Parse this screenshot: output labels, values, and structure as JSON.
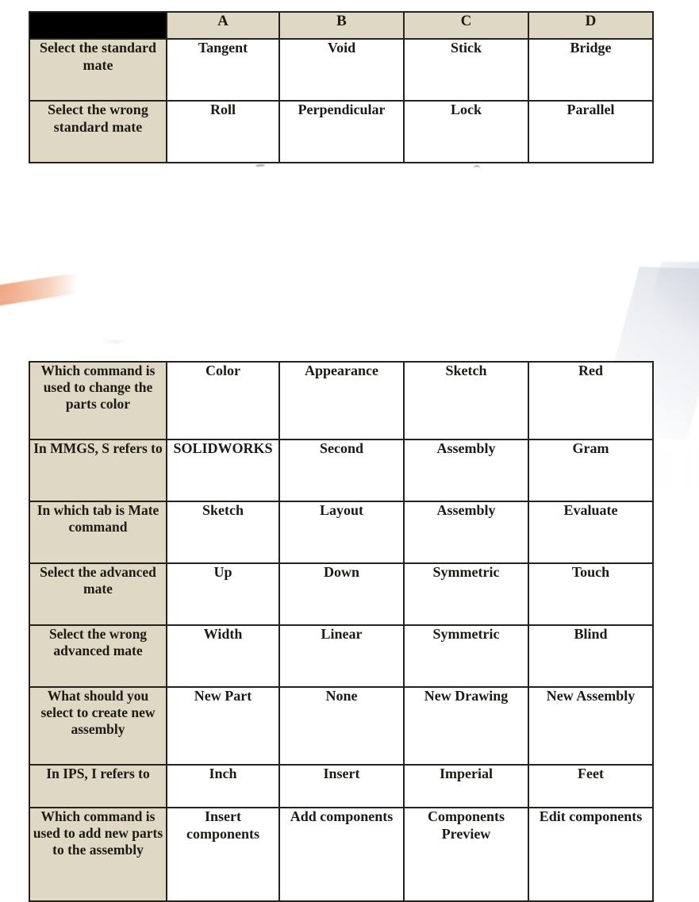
{
  "page": {
    "background_color": "#ffffff",
    "prompt_column_color": "#ded8c4",
    "header_blank_color": "#000000",
    "border_color": "#25211c",
    "option_cell_color": "#ffffff"
  },
  "tables": [
    {
      "id": "table-standard-mates",
      "has_header": true,
      "header": {
        "blank_label": "",
        "columns": [
          "A",
          "B",
          "C",
          "D"
        ]
      },
      "rows": [
        {
          "prompt": "Select the standard mate",
          "options": [
            "Tangent",
            "Void",
            "Stick",
            "Bridge"
          ],
          "height_class": "2"
        },
        {
          "prompt": "Select the wrong standard mate",
          "options": [
            "Roll",
            "Perpendicular",
            "Lock",
            "Parallel"
          ],
          "height_class": "2"
        }
      ]
    },
    {
      "id": "table-commands",
      "has_header": false,
      "rows": [
        {
          "prompt": "Which command is used to change the parts color",
          "options": [
            "Color",
            "Appearance",
            "Sketch",
            "Red"
          ],
          "height_class": "3"
        },
        {
          "prompt": "In MMGS, S refers to",
          "options": [
            "SOLIDWORKS",
            "Second",
            "Assembly",
            "Gram"
          ],
          "height_class": "2"
        },
        {
          "prompt": "In which tab is Mate command",
          "options": [
            "Sketch",
            "Layout",
            "Assembly",
            "Evaluate"
          ],
          "height_class": "2"
        },
        {
          "prompt": "Select the advanced mate",
          "options": [
            "Up",
            "Down",
            "Symmetric",
            "Touch"
          ],
          "height_class": "2"
        },
        {
          "prompt": "Select the wrong advanced mate",
          "options": [
            "Width",
            "Linear",
            "Symmetric",
            "Blind"
          ],
          "height_class": "2"
        },
        {
          "prompt": "What should you select to create new assembly",
          "options": [
            "New Part",
            "None",
            "New Drawing",
            "New Assembly"
          ],
          "height_class": "3"
        },
        {
          "prompt": "In IPS, I refers to",
          "options": [
            "Inch",
            "Insert",
            "Imperial",
            "Feet"
          ],
          "height_class": "1"
        },
        {
          "prompt": "Which command is used to add new parts to the assembly",
          "options": [
            "Insert components",
            "Add components",
            "Components Preview",
            "Edit components"
          ],
          "height_class": "4"
        }
      ]
    }
  ]
}
